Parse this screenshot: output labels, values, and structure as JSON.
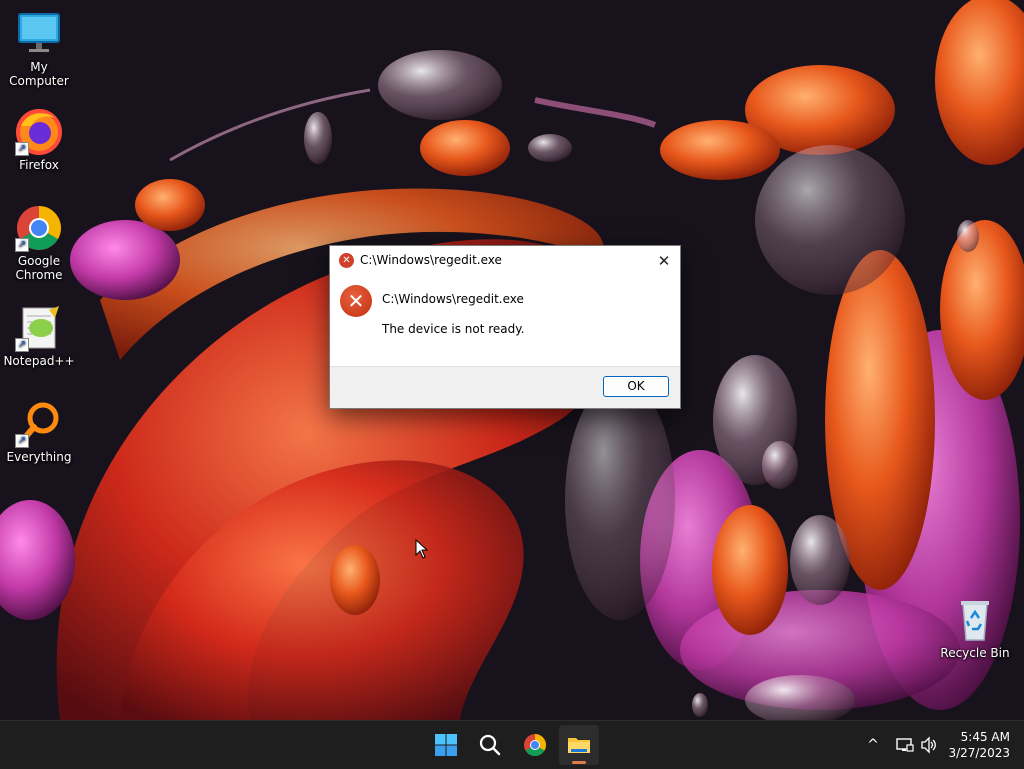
{
  "desktop": {
    "icons": [
      {
        "label": "My Computer",
        "icon": "monitor-icon"
      },
      {
        "label": "Firefox",
        "icon": "firefox-icon"
      },
      {
        "label": "Google Chrome",
        "icon": "chrome-icon"
      },
      {
        "label": "Notepad++",
        "icon": "notepadpp-icon"
      },
      {
        "label": "Everything",
        "icon": "everything-search-icon"
      },
      {
        "label": "Recycle Bin",
        "icon": "recycle-bin-icon"
      }
    ]
  },
  "dialog": {
    "title": "C:\\Windows\\regedit.exe",
    "path": "C:\\Windows\\regedit.exe",
    "message": "The device is not ready.",
    "ok_label": "OK",
    "close_glyph": "✕",
    "error_glyph": "✕",
    "accent_color": "#0067c0",
    "error_color": "#c2300f"
  },
  "taskbar": {
    "buttons": [
      {
        "name": "start",
        "icon": "windows-start-icon"
      },
      {
        "name": "search",
        "icon": "search-icon"
      },
      {
        "name": "chrome",
        "icon": "chrome-icon"
      },
      {
        "name": "file-explorer",
        "icon": "folder-icon",
        "active": true
      }
    ],
    "tray": {
      "overflow_glyph": "^",
      "network_icon": "network-icon",
      "volume_icon": "speaker-icon"
    },
    "clock": {
      "time": "5:45 AM",
      "date": "3/27/2023"
    }
  }
}
